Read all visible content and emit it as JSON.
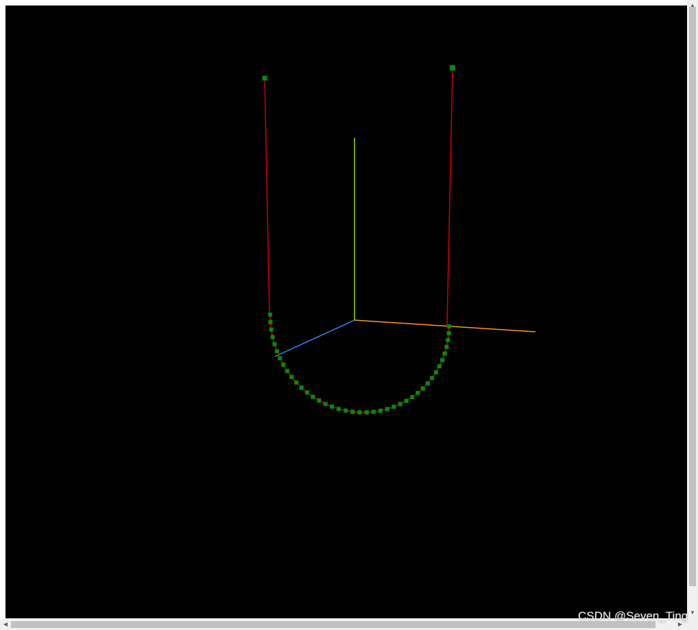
{
  "scene": {
    "background_color": "#000000",
    "axis_colors": {
      "x_axis": "#ff9a1f",
      "y_axis": "#8fdc1a",
      "z_axis": "#2a8cff"
    },
    "curve_color": "#d40000",
    "marker_color": "#0a8a0a",
    "marker_outline_color": "#005500"
  },
  "scrollbars": {
    "vertical_up_icon": "triangle-up-icon",
    "vertical_down_icon": "triangle-down-icon",
    "horizontal_left_icon": "triangle-left-icon",
    "horizontal_right_icon": "triangle-right-icon",
    "up_glyph": "▲",
    "down_glyph": "▼",
    "left_glyph": "◀",
    "right_glyph": "▶"
  },
  "watermark": {
    "text": "CSDN @Seven_Ting"
  }
}
